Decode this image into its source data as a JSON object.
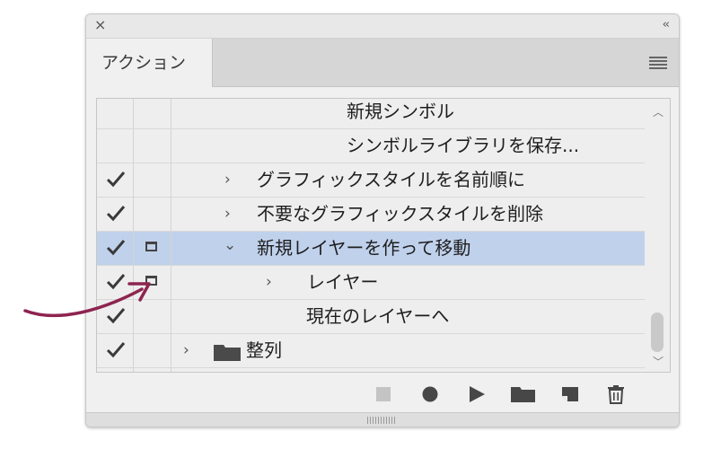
{
  "panel": {
    "close_glyph": "×",
    "collapse_glyph": "‹‹",
    "tab_label": "アクション",
    "menu_icon": "panel-menu-icon"
  },
  "rows": [
    {
      "label": "新規シンボル",
      "check": false,
      "dialog": false,
      "chevron": "",
      "folder": false,
      "selected": false
    },
    {
      "label": "シンボルライブラリを保存...",
      "check": false,
      "dialog": false,
      "chevron": "",
      "folder": false,
      "selected": false
    },
    {
      "label": "グラフィックスタイルを名前順に",
      "check": true,
      "dialog": false,
      "chevron": "›",
      "folder": false,
      "selected": false
    },
    {
      "label": "不要なグラフィックスタイルを削除",
      "check": true,
      "dialog": false,
      "chevron": "›",
      "folder": false,
      "selected": false
    },
    {
      "label": "新規レイヤーを作って移動",
      "check": true,
      "dialog": true,
      "chevron": "⌄",
      "folder": false,
      "selected": true
    },
    {
      "label": "レイヤー",
      "check": true,
      "dialog": true,
      "chevron": "›",
      "folder": false,
      "selected": false
    },
    {
      "label": "現在のレイヤーへ",
      "check": true,
      "dialog": false,
      "chevron": "",
      "folder": false,
      "selected": false
    },
    {
      "label": "整列",
      "check": true,
      "dialog": false,
      "chevron": "›",
      "folder": true,
      "selected": false
    }
  ],
  "toolbar": {
    "icons": [
      "stop-icon",
      "record-icon",
      "play-icon",
      "new-set-folder-icon",
      "new-action-icon",
      "trash-icon"
    ]
  },
  "colors": {
    "selected_row": "#c0d1ec",
    "annotation_arrow": "#8e2450"
  }
}
